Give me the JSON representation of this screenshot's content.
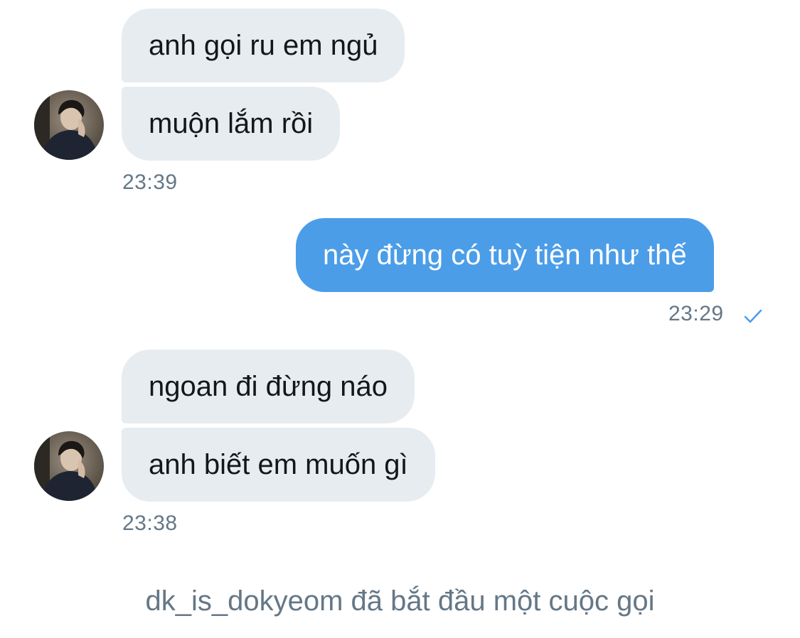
{
  "conversation": {
    "group1": {
      "messages": [
        "anh gọi ru em ngủ",
        "muộn lắm rồi"
      ],
      "time": "23:39",
      "avatar_icon": "user-avatar-photo"
    },
    "group2": {
      "message": "này đừng có tuỳ tiện như thế",
      "time": "23:29",
      "status_icon": "checkmark-icon"
    },
    "group3": {
      "messages": [
        "ngoan đi đừng náo",
        "anh biết em muốn gì"
      ],
      "time": "23:38",
      "avatar_icon": "user-avatar-photo"
    },
    "system_message": "dk_is_dokyeom đã bắt đầu một cuộc gọi"
  },
  "colors": {
    "incoming_bubble": "#e6ecf0",
    "outgoing_bubble": "#4b9de8",
    "meta_text": "#657786",
    "message_text": "#14171a"
  }
}
